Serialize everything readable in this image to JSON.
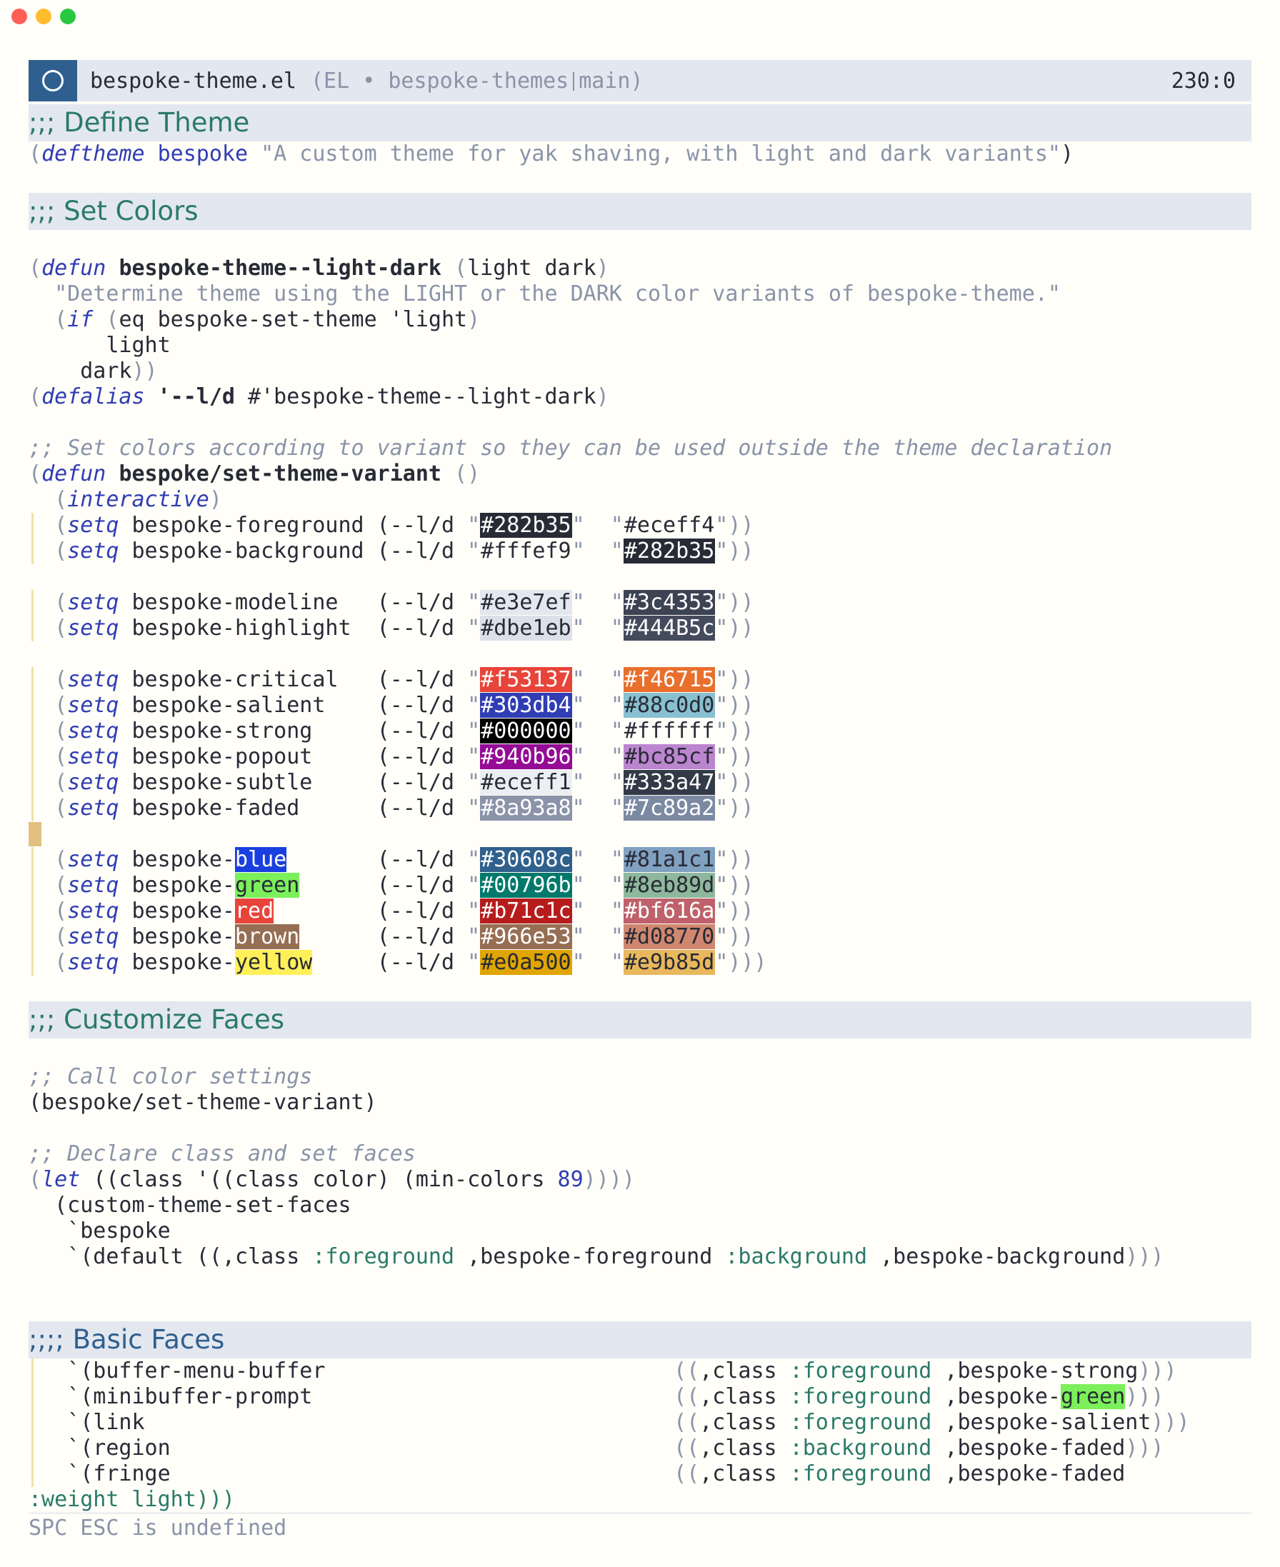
{
  "window": {
    "controls": [
      "#ff5f57",
      "#febc2e",
      "#28c840"
    ]
  },
  "modeline": {
    "filename": "bespoke-theme.el",
    "mode_info": "(EL • bespoke-themes",
    "branch": "main)",
    "position": "230:0"
  },
  "headers": {
    "define_theme": ";;; Define Theme",
    "set_colors": ";;; Set Colors",
    "customize_faces": ";;; Customize Faces",
    "basic_faces": ";;;; Basic Faces"
  },
  "code": {
    "deftheme_kw": "deftheme",
    "deftheme_name": "bespoke",
    "deftheme_doc": "\"A custom theme for yak shaving, with light and dark variants\"",
    "defun_kw": "defun",
    "light_dark_fn": "bespoke-theme--light-dark",
    "light_dark_args": "light dark",
    "light_dark_doc": "\"Determine theme using the LIGHT or the DARK color variants of bespoke-theme.\"",
    "if_kw": "if",
    "if_cond": "eq bespoke-set-theme 'light",
    "light_word": "light",
    "dark_word": "dark",
    "defalias_kw": "defalias",
    "defalias_sym": "'--l/d",
    "defalias_target": " #'bespoke-theme--light-dark",
    "comment_variant": ";; Set colors according to variant so they can be used outside the theme declaration",
    "set_variant_fn": "bespoke/set-theme-variant",
    "interactive_kw": "interactive",
    "setq_kw": "setq",
    "ld_call": "(--l/d",
    "comment_call": ";; Call color settings",
    "call_variant": "(bespoke/set-theme-variant)",
    "comment_declare": ";; Declare class and set faces",
    "let_kw": "let",
    "let_rest1": "((class '((class color) (min-colors ",
    "let_num": "89",
    "let_rest2": "))))",
    "custom_set_faces": "(custom-theme-set-faces",
    "bespoke_sym": "`bespoke",
    "default_open": "`(default ((,class ",
    "fg_kw": ":foreground",
    "bg_kw": ":background",
    "default_fg_var": " ,bespoke-foreground ",
    "default_bg_var": " ,bespoke-background",
    "default_close": ")))",
    "weight_line": ":weight light)))"
  },
  "color_settings": [
    {
      "var": "bespoke-foreground",
      "light": "#282b35",
      "dark": "#eceff4",
      "light_bg": "#282b35",
      "dark_bg": ""
    },
    {
      "var": "bespoke-background",
      "light": "#fffef9",
      "dark": "#282b35",
      "light_bg": "",
      "dark_bg": "#282b35"
    },
    {
      "var": "bespoke-modeline",
      "light": "#e3e7ef",
      "dark": "#3c4353",
      "light_bg": "#e3e7ef",
      "dark_bg": "#3c4353"
    },
    {
      "var": "bespoke-highlight",
      "light": "#dbe1eb",
      "dark": "#444B5c",
      "light_bg": "#dbe1eb",
      "dark_bg": "#444b5c"
    },
    {
      "var": "bespoke-critical",
      "light": "#f53137",
      "dark": "#f46715",
      "light_bg": "#e8443a",
      "dark_bg": "#e86f2c"
    },
    {
      "var": "bespoke-salient",
      "light": "#303db4",
      "dark": "#88c0d0",
      "light_bg": "#303db4",
      "dark_bg": "#88c0d0"
    },
    {
      "var": "bespoke-strong",
      "light": "#000000",
      "dark": "#ffffff",
      "light_bg": "#000000",
      "dark_bg": ""
    },
    {
      "var": "bespoke-popout",
      "light": "#940b96",
      "dark": "#bc85cf",
      "light_bg": "#940b96",
      "dark_bg": "#bc85cf"
    },
    {
      "var": "bespoke-subtle",
      "light": "#eceff1",
      "dark": "#333a47",
      "light_bg": "#eceff1",
      "dark_bg": "#333a47"
    },
    {
      "var": "bespoke-faded",
      "light": "#8a93a8",
      "dark": "#7c89a2",
      "light_bg": "#8a93a8",
      "dark_bg": "#7c89a2"
    },
    {
      "var_prefix": "bespoke-",
      "var_suffix": "blue",
      "var_bg": "#1a3fe0",
      "light": "#30608c",
      "dark": "#81a1c1",
      "light_bg": "#30608c",
      "dark_bg": "#81a1c1"
    },
    {
      "var_prefix": "bespoke-",
      "var_suffix": "green",
      "var_bg": "#7bf05a",
      "light": "#00796b",
      "dark": "#8eb89d",
      "light_bg": "#00796b",
      "dark_bg": "#8eb89d"
    },
    {
      "var_prefix": "bespoke-",
      "var_suffix": "red",
      "var_bg": "#e8443a",
      "light": "#b71c1c",
      "dark": "#bf616a",
      "light_bg": "#b71c1c",
      "dark_bg": "#bf616a"
    },
    {
      "var_prefix": "bespoke-",
      "var_suffix": "brown",
      "var_bg": "#966e53",
      "light": "#966e53",
      "dark": "#d08770",
      "light_bg": "#966e53",
      "dark_bg": "#d08770"
    },
    {
      "var_prefix": "bespoke-",
      "var_suffix": "yellow",
      "var_bg": "#fff05a",
      "light": "#e0a500",
      "dark": "#e9b85d",
      "light_bg": "#e0a500",
      "dark_bg": "#e9b85d"
    }
  ],
  "basic_faces": [
    {
      "face": "`(buffer-menu-buffer",
      "kw": ":foreground",
      "val": ",bespoke-strong",
      "close": ")))"
    },
    {
      "face": "`(minibuffer-prompt",
      "kw": ":foreground",
      "val_prefix": ",bespoke-",
      "val_hl": "green",
      "close": ")))"
    },
    {
      "face": "`(link",
      "kw": ":foreground",
      "val": ",bespoke-salient",
      "close": ")))"
    },
    {
      "face": "`(region",
      "kw": ":background",
      "val": ",bespoke-faded",
      "close": ")))"
    },
    {
      "face": "`(fringe",
      "kw": ":foreground",
      "val": ",bespoke-faded",
      "close": ""
    }
  ],
  "basic_open": "((,class ",
  "echo_area": "SPC ESC is undefined"
}
